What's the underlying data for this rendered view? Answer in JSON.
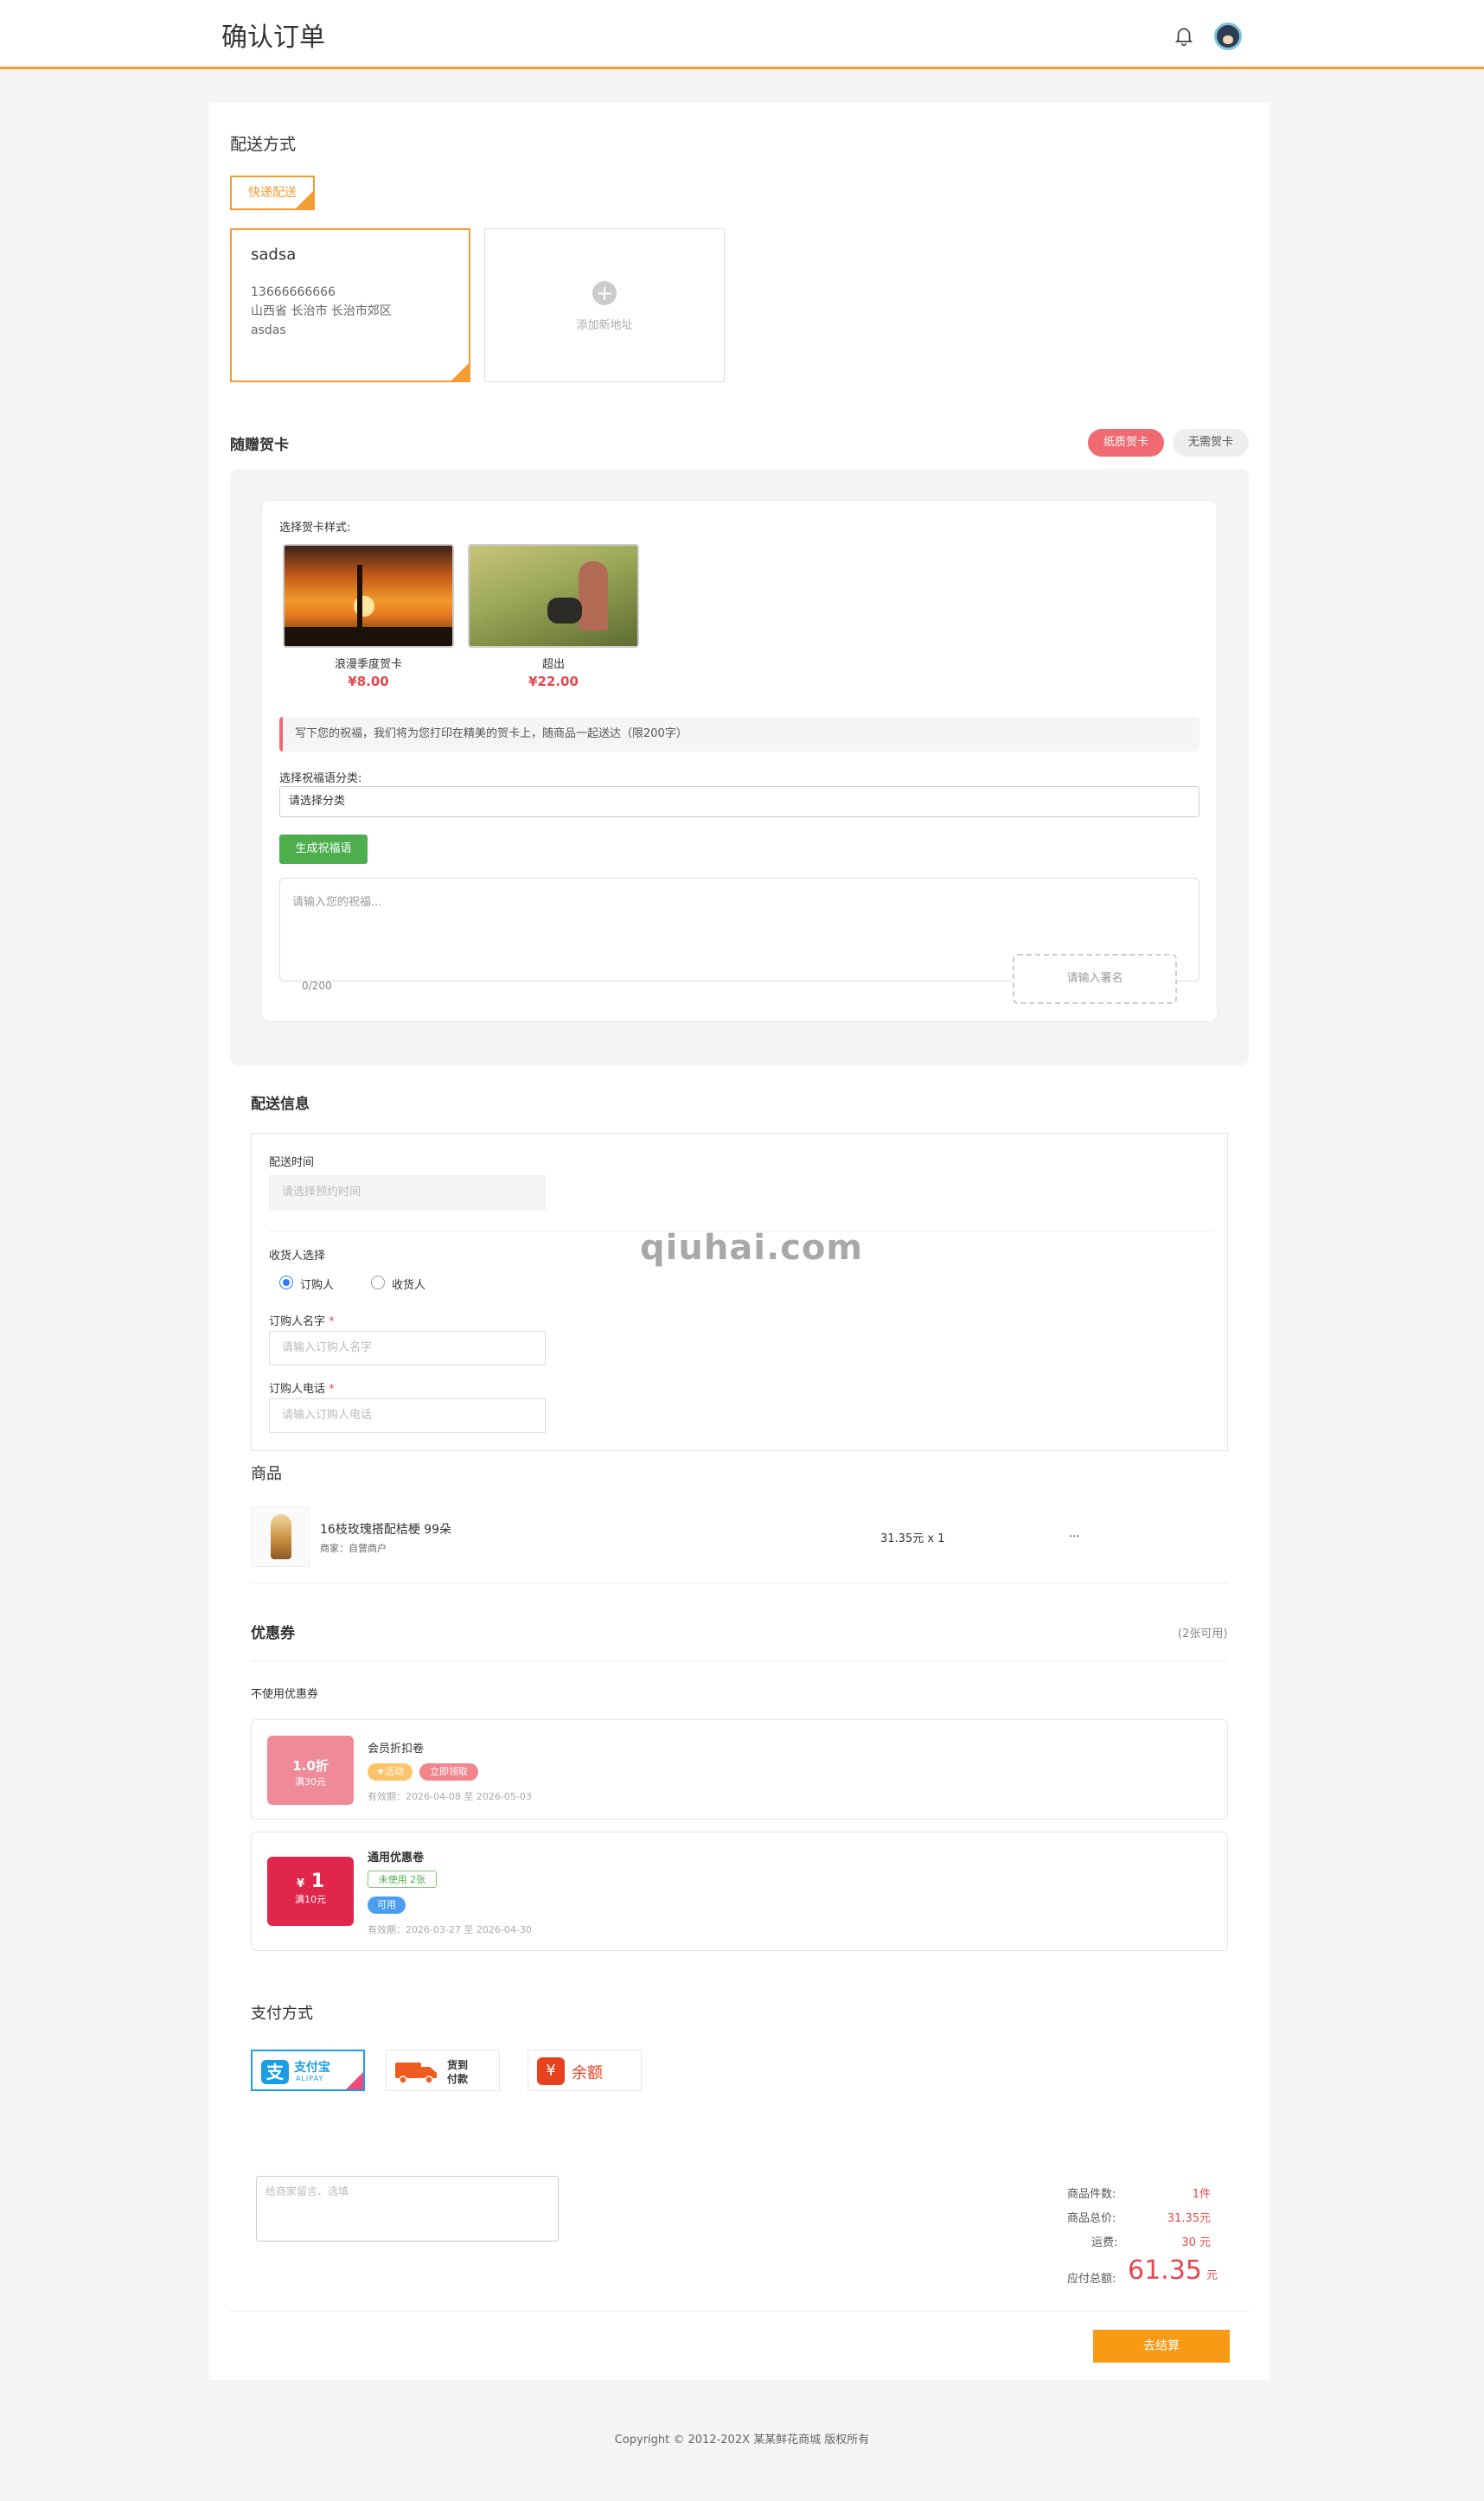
{
  "header": {
    "title": "确认订单"
  },
  "delivery": {
    "title": "配送方式",
    "method_tag": "快递配送",
    "address": {
      "name": "sadsa",
      "phone": "13666666666",
      "region": "山西省 长治市 长治市郊区",
      "detail": "asdas"
    },
    "add_label": "添加新地址"
  },
  "greeting": {
    "title": "随赠贺卡",
    "pill_on": "纸质贺卡",
    "pill_off": "无需贺卡",
    "style_label": "选择贺卡样式:",
    "styles": [
      {
        "name": "浪漫季度贺卡",
        "price": "¥8.00"
      },
      {
        "name": "超出",
        "price": "¥22.00"
      }
    ],
    "tip": "写下您的祝福，我们将为您打印在精美的贺卡上，随商品一起送达（限200字）",
    "category_label": "选择祝福语分类:",
    "category_value": "请选择分类",
    "generate_button": "生成祝福语",
    "message_placeholder": "请输入您的祝福...",
    "count": "0/200",
    "sign_placeholder": "请输入署名"
  },
  "info": {
    "title": "配送信息",
    "time_label": "配送时间",
    "time_placeholder": "请选择预约时间",
    "receiver_label": "收货人选择",
    "radio_1": "订购人",
    "radio_2": "收货人",
    "name_label": "订购人名字",
    "name_placeholder": "请输入订购人名字",
    "phone_label": "订购人电话",
    "phone_placeholder": "请输入订购人电话",
    "required_mark": "*"
  },
  "product": {
    "title": "商品",
    "name": "16枝玫瑰搭配桔梗  99朵",
    "shop": "商家：自营商户",
    "price_qty": "31.35元 x 1",
    "more": "..."
  },
  "coupons": {
    "title": "优惠券",
    "available": "(2张可用)",
    "none_label": "不使用优惠券",
    "items": [
      {
        "value": "1.0折",
        "condition": "满30元",
        "name": "会员折扣卷",
        "tag_1": "★活动",
        "tag_2": "立即领取",
        "validity": "有效期：2026-04-08 至 2026-05-03",
        "color": "#ef8a98"
      },
      {
        "value_prefix": "¥",
        "value": "1",
        "condition": "满10元",
        "name": "通用优惠卷",
        "tag_1": "未使用 2张",
        "tag_2": "可用",
        "validity": "有效期：2026-03-27 至 2026-04-30",
        "color": "#e0264a"
      }
    ]
  },
  "payment": {
    "title": "支付方式",
    "alipay_cn": "支付宝",
    "alipay_en": "ALIPAY",
    "cod_line1": "货到",
    "cod_line2": "付款",
    "balance": "余额"
  },
  "summary": {
    "remark_placeholder": "给商家留言、选填",
    "count_label": "商品件数:",
    "count_value": "1件",
    "total_label": "商品总价:",
    "total_value": "31.35元",
    "freight_label": "运费:",
    "freight_value": "30 元",
    "payable_label": "应付总额:",
    "payable_value": "61.35",
    "payable_unit": "元",
    "submit": "去结算"
  },
  "footer": {
    "copyright": "Copyright © 2012-202X 某某鲜花商城 版权所有"
  },
  "watermark": "qiuhai.com"
}
